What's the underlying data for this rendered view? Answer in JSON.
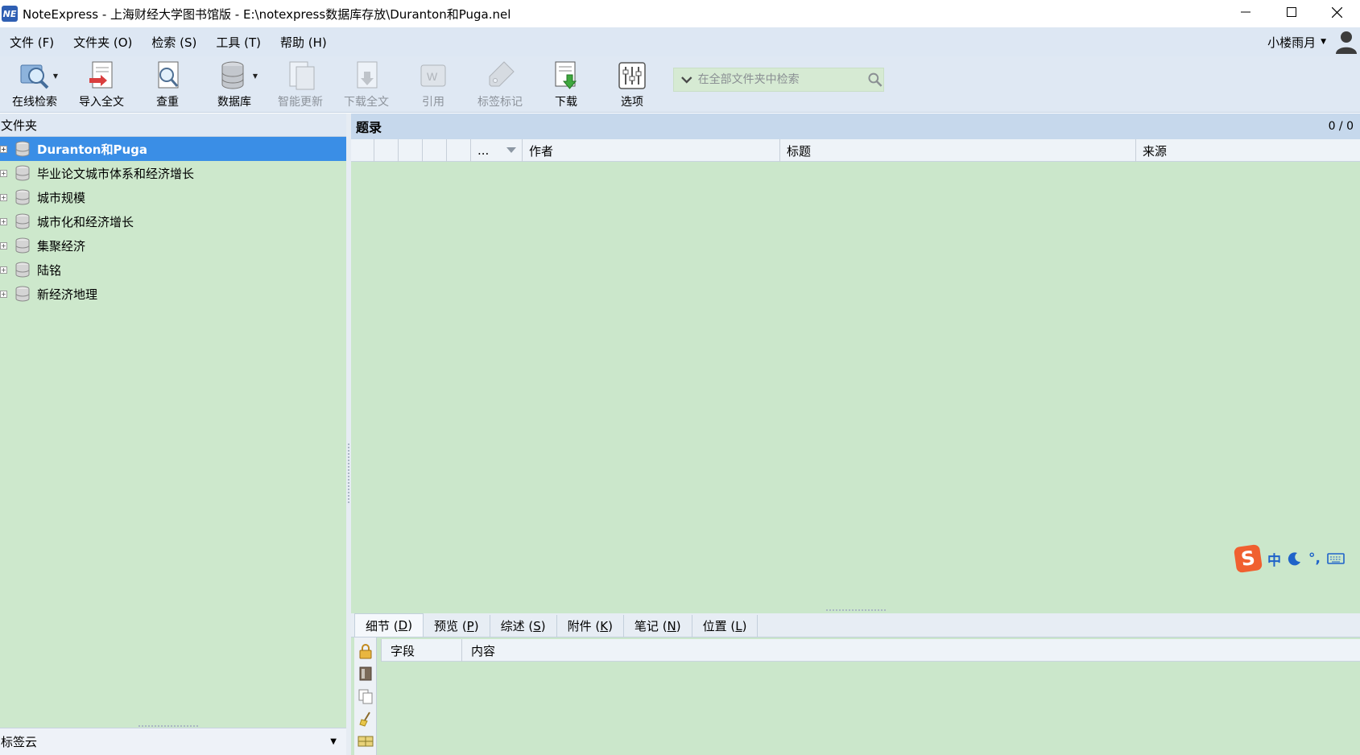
{
  "window": {
    "app_icon_text": "NE",
    "title": "NoteExpress - 上海财经大学图书馆版 - E:\\notexpress数据库存放\\Duranton和Puga.nel"
  },
  "menu": {
    "items": [
      "文件 (F)",
      "文件夹 (O)",
      "检索 (S)",
      "工具 (T)",
      "帮助 (H)"
    ],
    "user_name": "小楼雨月"
  },
  "toolbar": {
    "buttons": [
      {
        "label": "在线检索",
        "icon": "online-search-icon",
        "enabled": true
      },
      {
        "label": "导入全文",
        "icon": "import-fulltext-icon",
        "enabled": true
      },
      {
        "label": "查重",
        "icon": "dedupe-icon",
        "enabled": true
      },
      {
        "label": "数据库",
        "icon": "database-icon",
        "enabled": true
      },
      {
        "label": "智能更新",
        "icon": "smart-update-icon",
        "enabled": false
      },
      {
        "label": "下载全文",
        "icon": "download-fulltext-icon",
        "enabled": false
      },
      {
        "label": "引用",
        "icon": "cite-icon",
        "enabled": false
      },
      {
        "label": "标签标记",
        "icon": "tag-icon",
        "enabled": false
      },
      {
        "label": "下载",
        "icon": "download-icon",
        "enabled": true
      },
      {
        "label": "选项",
        "icon": "options-icon",
        "enabled": true
      }
    ],
    "search_placeholder": "在全部文件夹中检索"
  },
  "left_panel": {
    "header": "文件夹",
    "tree": [
      {
        "label": "Duranton和Puga",
        "selected": true
      },
      {
        "label": "毕业论文城市体系和经济增长",
        "selected": false
      },
      {
        "label": "城市规模",
        "selected": false
      },
      {
        "label": "城市化和经济增长",
        "selected": false
      },
      {
        "label": "集聚经济",
        "selected": false
      },
      {
        "label": "陆铭",
        "selected": false
      },
      {
        "label": "新经济地理",
        "selected": false
      }
    ],
    "tag_cloud": "标签云"
  },
  "records": {
    "title": "题录",
    "count": "0 / 0",
    "columns": [
      "...",
      "作者",
      "标题",
      "来源"
    ]
  },
  "detail": {
    "tabs": [
      {
        "text": "细节 (",
        "key": "D",
        "end": ")"
      },
      {
        "text": "预览 (",
        "key": "P",
        "end": ")"
      },
      {
        "text": "综述 (",
        "key": "S",
        "end": ")"
      },
      {
        "text": "附件 (",
        "key": "K",
        "end": ")"
      },
      {
        "text": "笔记 (",
        "key": "N",
        "end": ")"
      },
      {
        "text": "位置 (",
        "key": "L",
        "end": ")"
      }
    ],
    "columns": [
      "字段",
      "内容"
    ]
  },
  "ime": {
    "logo": "S",
    "mode": "中",
    "punct": "°,"
  },
  "colors": {
    "selection": "#3a8ee6",
    "list_background": "#cbe7cb",
    "toolbar_background": "#dfe8f3"
  }
}
